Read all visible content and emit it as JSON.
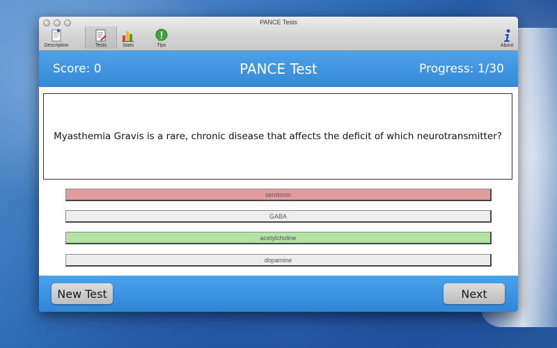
{
  "window": {
    "title": "PANCE Tests"
  },
  "toolbar": {
    "items": [
      {
        "label": "Description",
        "icon": "document-info-icon"
      },
      {
        "label": "Tests",
        "icon": "test-sheet-icon"
      },
      {
        "label": "Stats",
        "icon": "bar-chart-icon"
      },
      {
        "label": "Tips",
        "icon": "exclamation-bubble-icon"
      },
      {
        "label": "About",
        "icon": "info-icon"
      }
    ],
    "active": "Tests"
  },
  "header": {
    "score": "Score: 0",
    "title": "PANCE Test",
    "progress": "Progress: 1/30"
  },
  "question": "Myasthemia Gravis is a rare, chronic disease that affects the deficit of which neurotransmitter?",
  "answers": [
    {
      "label": "serotonin",
      "state": "incorrect",
      "color": "#e39c9c"
    },
    {
      "label": "GABA",
      "state": "neutral",
      "color": "#ededed"
    },
    {
      "label": "acetylcholine",
      "state": "correct",
      "color": "#b2e3a2"
    },
    {
      "label": "dopamine",
      "state": "neutral",
      "color": "#ededed"
    }
  ],
  "footer": {
    "new_test_label": "New Test",
    "next_label": "Next"
  },
  "colors": {
    "header_blue": "#3d93de",
    "footer_blue": "#3a8fdc",
    "incorrect": "#e39c9c",
    "correct": "#b2e3a2",
    "neutral": "#ededed"
  }
}
